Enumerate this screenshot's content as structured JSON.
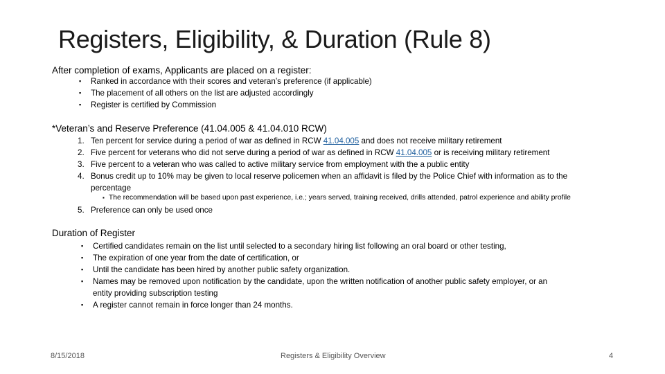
{
  "slide": {
    "title": "Registers, Eligibility, & Duration (Rule 8)",
    "section1": {
      "heading": "After completion of exams, Applicants are placed on a register:",
      "bullets": [
        "Ranked in accordance with their scores and veteran’s preference (if applicable)",
        "The placement of all others on the list are adjusted accordingly",
        "Register is certified by Commission"
      ]
    },
    "section2": {
      "heading": "*Veteran’s and Reserve Preference (41.04.005 & 41.04.010 RCW)",
      "items": [
        {
          "num": "1.",
          "pre": "Ten percent for service during a period of war as defined in RCW ",
          "link": "41.04.005",
          "post": " and does not receive military retirement"
        },
        {
          "num": "2.",
          "pre": "Five percent for veterans who did not serve during a period of war as defined in RCW ",
          "link": "41.04.005",
          "post": " or is receiving military retirement"
        },
        {
          "num": "3.",
          "text": "Five percent to a veteran who was called to active military service from employment with the a public entity"
        },
        {
          "num": "4.",
          "line1": "Bonus credit up to 10% may be given to local reserve policemen when an affidavit is filed by the Police Chief with information as to the",
          "line2": "percentage"
        },
        {
          "num": "5.",
          "text": "Preference can only be used once"
        }
      ],
      "sub_bullet": "The recommendation will be based upon past experience, i.e.; years served, training received, drills attended, patrol experience and ability profile"
    },
    "section3": {
      "heading": "Duration of Register",
      "bullets": [
        "Certified candidates remain on the list until selected to a secondary hiring list following an oral board or other testing,",
        "The expiration of one year from the date of certification, or",
        "Until the candidate has been hired by another public safety organization.",
        "Names may be removed upon notification by the candidate, upon the written notification of another public safety employer, or an",
        "A register cannot remain in force longer than 24 months."
      ],
      "bullet4_line2": "entity providing subscription testing"
    },
    "bullet_glyph": "▪",
    "footer": {
      "date": "8/15/2018",
      "center": "Registers & Eligibility Overview",
      "page": "4"
    }
  }
}
